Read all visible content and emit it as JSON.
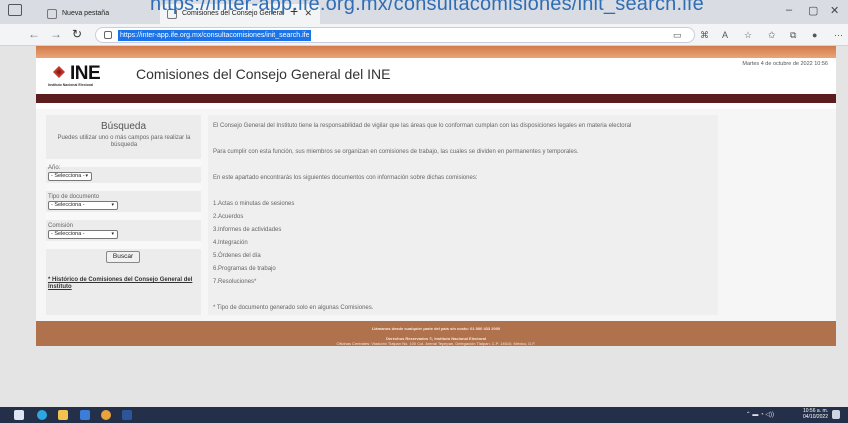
{
  "overlay_url": "https://inter-app.ife.org.mx/consultacomisiones/init_search.ife",
  "browser": {
    "tabs": [
      {
        "title": "Nueva pestaña",
        "active": false
      },
      {
        "title": "Comisiones del Consejo General",
        "active": true
      }
    ],
    "address": "https://inter-app.ife.org.mx/consultacomisiones/init_search.ife"
  },
  "site": {
    "logo_text": "INE",
    "logo_subtext": "Instituto Nacional Electoral",
    "title": "Comisiones del Consejo General del INE",
    "date": "Martes 4 de octubre de 2022 10:56",
    "colors": {
      "banner": "#d27b4a",
      "maroon": "#5b1d1d",
      "footer": "#b0714d"
    }
  },
  "search": {
    "title": "Búsqueda",
    "hint": "Puedes utilizar uno o más campos para realizar la búsqueda",
    "year_label": "Año:",
    "year_value": "- Selecciona -",
    "doc_label": "Tipo de documento",
    "doc_value": "- Selecciona -",
    "commission_label": "Comisión",
    "commission_value": "- Selecciona -",
    "button": "Buscar",
    "history_link": "* Histórico de Comisiones del Consejo General del Instituto"
  },
  "content": {
    "p1": "El Consejo General del Instituto tiene la responsabilidad de vigilar que las áreas que lo conforman cumplan con las disposiciones legales en materia electoral",
    "p2": "Para cumplir con esta función, sus miembros se organizan en comisiones de trabajo, las cuales se dividen en permanentes y temporales.",
    "p3": "En este apartado encontrarás los siguientes documentos con información sobre dichas comisiones:",
    "items": [
      "1.Actas o minutas de sesiones",
      "2.Acuerdos",
      "3.Informes de actividades",
      "4.Integración",
      "5.Órdenes del día",
      "6.Programas de trabajo",
      "7.Resoluciones*"
    ],
    "note": "* Tipo de documento generado solo en algunas Comisiones."
  },
  "footer": {
    "line1": "Llámanos desde cualquier parte del país sin costo: 01 800 433 2000",
    "line2": "Derechos Reservados ©, Instituto Nacional Electoral",
    "line3": "Oficinas Centrales: Viaducto Tlalpan No. 100 Col. Arenal Tepepan, Delegación Tlalpan, C.P. 14610, México, D.F."
  },
  "taskbar": {
    "time": "10:56 a. m.",
    "date": "04/10/2022"
  }
}
